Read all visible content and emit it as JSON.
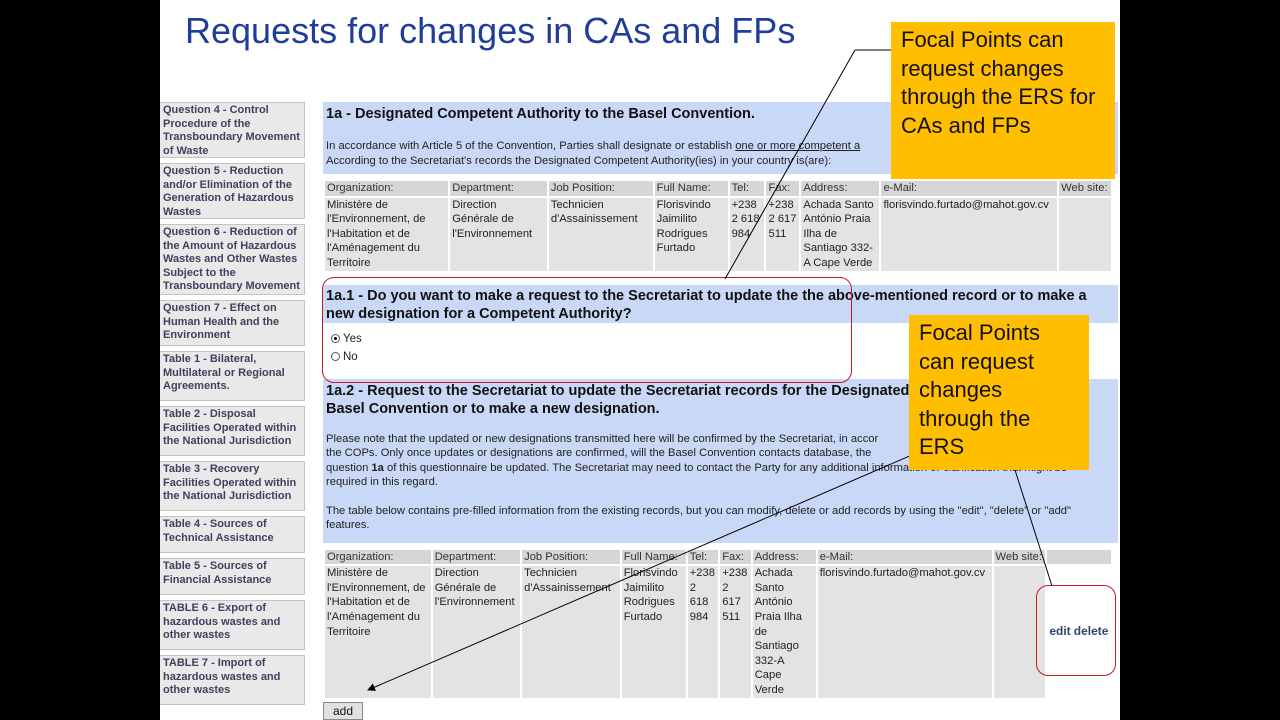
{
  "slide": {
    "title": "Requests for changes in CAs and FPs"
  },
  "sidebar": {
    "items": [
      {
        "label": "Question 4 - Control Procedure of the Transboundary Movement of Waste"
      },
      {
        "label": "Question 5 - Reduction and/or Elimination of the Generation of Hazardous Wastes"
      },
      {
        "label": "Question 6 - Reduction of the Amount of Hazardous Wastes and Other Wastes Subject to the Transboundary Movement"
      },
      {
        "label": "Question 7 - Effect on Human Health and the Environment"
      },
      {
        "label": "Table 1 - Bilateral, Multilateral or Regional Agreements."
      },
      {
        "label": "Table 2 - Disposal Facilities Operated within the National Jurisdiction"
      },
      {
        "label": "Table 3 - Recovery Facilities Operated within the National Jurisdiction"
      },
      {
        "label": "Table 4 - Sources of Technical Assistance"
      },
      {
        "label": "Table 5 - Sources of Financial Assistance"
      },
      {
        "label": "TABLE 6 - Export of hazardous wastes and other wastes"
      },
      {
        "label": "TABLE 7 - Import of hazardous wastes and other wastes"
      }
    ]
  },
  "section1a": {
    "title": "1a - Designated Competent Authority to the Basel Convention.",
    "para_prefix": "In accordance with Article 5 of the Convention, Parties shall designate or establish ",
    "para_underlined": "one or more competent a",
    "para_line2": "According to the Secretariat's records the Designated Competent Authority(ies) in your country is(are):"
  },
  "table_headers": {
    "organization": "Organization:",
    "department": "Department:",
    "job_position": "Job Position:",
    "full_name": "Full Name:",
    "tel": "Tel:",
    "fax": "Fax:",
    "address": "Address:",
    "email": "e-Mail:",
    "website": "Web site:"
  },
  "record": {
    "organization": "Ministère de l'Environnement, de l'Habitation et de l'Aménagement du Territoire",
    "department": "Direction Générale de l'Environnement",
    "job_position": "Technicien d'Assainissement",
    "full_name": "Florisvindo Jaimilito Rodrigues Furtado",
    "tel": "+238 2 618 984",
    "fax": "+238 2 617 511",
    "address_1": "Achada Santo António Praia Ilha de Santiago 332-A Cape Verde",
    "address_2": "Achada Santo António Praia Ilha de Santiago 332-A Cape Verde",
    "email": "florisvindo.furtado@mahot.gov.cv",
    "website": ""
  },
  "question_1a1": {
    "title": "1a.1 - Do you want to make a request to the Secretariat to update the the above-mentioned record or to make a new designation for a Competent Authority?",
    "options": [
      {
        "label": "Yes",
        "selected": true
      },
      {
        "label": "No",
        "selected": false
      }
    ]
  },
  "section_1a2": {
    "title_visible": "1a.2 - Request to the Secretariat to update the Secretariat records for the Designated",
    "title_tail": "Basel",
    "title_line2": "Basel Convention or to make a new designation.",
    "para1_line1": "Please note that the updated or new designations transmitted here will be confirmed by the Secretariat, in accor",
    "para1_line1_tail": "of",
    "para1_line2": "the COPs. Only once updates or designations are confirmed, will the Basel Convention contacts database, the",
    "para1_line2_tail": "er",
    "para1_line3_pre": "question ",
    "para1_line3_bold": "1a",
    "para1_line3_post": " of this questionnaire be updated. The Secretariat may need to contact the Party for any additional information or clarification that might be",
    "para1_line4": "required in this regard.",
    "para2": "The table below contains pre-filled information from the existing records, but you can modify, delete or add records by using the \"edit\", \"delete\" or \"add\" features."
  },
  "actions": {
    "edit": "edit",
    "delete": "delete",
    "add": "add"
  },
  "callouts": {
    "top": "Focal Points can request changes through the ERS for CAs and FPs",
    "middle": "Focal Points can request changes through the ERS"
  },
  "colors": {
    "title_blue": "#1f3d99",
    "callout_orange": "#ffbe00",
    "section_blue": "#c9d8f7",
    "outline_red": "#c4182b"
  }
}
